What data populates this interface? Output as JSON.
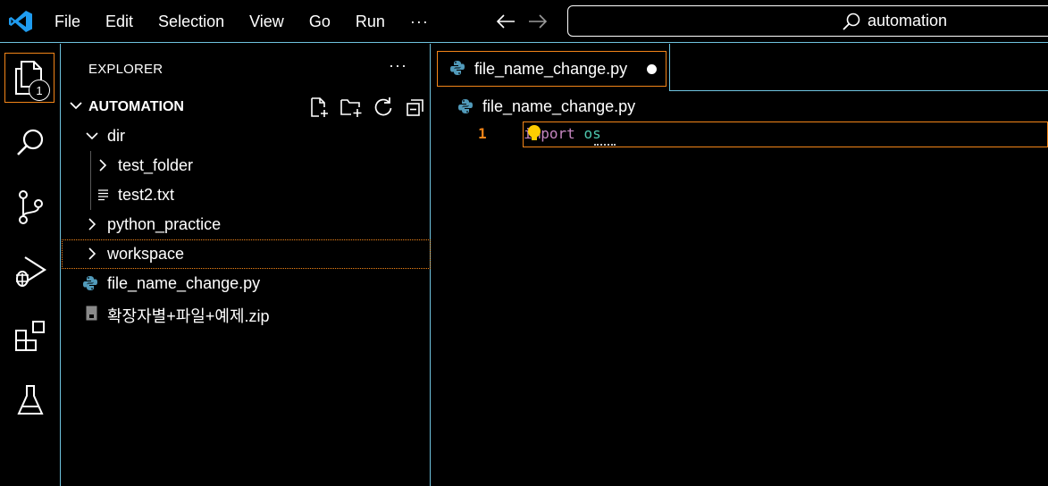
{
  "menu": {
    "items": [
      "File",
      "Edit",
      "Selection",
      "View",
      "Go",
      "Run"
    ],
    "more": "···"
  },
  "command_center": {
    "text": "automation"
  },
  "activity": {
    "explorer_badge": "1"
  },
  "sidebar": {
    "title": "EXPLORER",
    "more": "···",
    "section": "AUTOMATION",
    "tree": [
      {
        "label": "dir"
      },
      {
        "label": "test_folder"
      },
      {
        "label": "test2.txt"
      },
      {
        "label": "python_practice"
      },
      {
        "label": "workspace"
      },
      {
        "label": "file_name_change.py"
      },
      {
        "label": "확장자별+파일+예제.zip"
      }
    ]
  },
  "editor": {
    "tab_label": "file_name_change.py",
    "breadcrumb": "file_name_change.py",
    "line_number": "1",
    "code_keyword": "import",
    "code_module": "os"
  },
  "colors": {
    "focus_border": "#f38518",
    "contrast_border": "#6fc3df",
    "python_icon": "#519aba"
  }
}
